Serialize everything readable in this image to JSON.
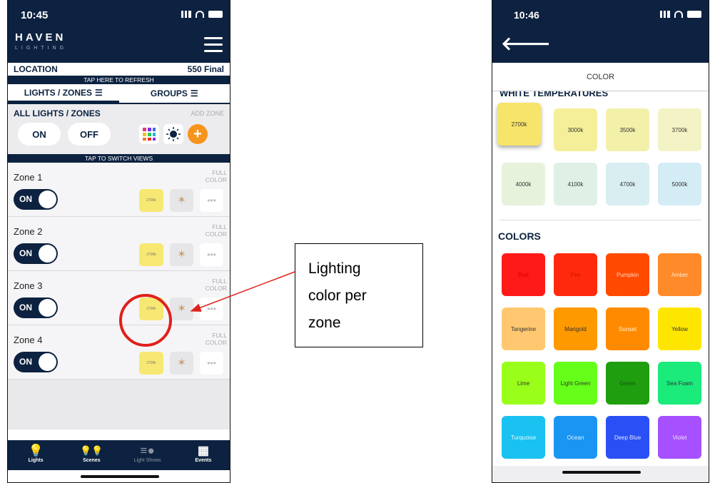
{
  "left": {
    "time": "10:45",
    "brand": "HAVEN",
    "brand_sub": "LIGHTING",
    "location_label": "LOCATION",
    "location_value": "550 Final",
    "refresh": "TAP HERE TO REFRESH",
    "tabs": [
      "LIGHTS / ZONES",
      "GROUPS"
    ],
    "all_title": "ALL LIGHTS / ZONES",
    "add_zone": "ADD ZONE",
    "on": "ON",
    "off": "OFF",
    "switch_views": "TAP TO SWITCH VIEWS",
    "zones": [
      {
        "name": "Zone 1",
        "full": "FULL",
        "color": "COLOR",
        "state": "ON",
        "swatch": "2700k"
      },
      {
        "name": "Zone 2",
        "full": "FULL",
        "color": "COLOR",
        "state": "ON",
        "swatch": "2700k"
      },
      {
        "name": "Zone 3",
        "full": "FULL",
        "color": "COLOR",
        "state": "ON",
        "swatch": "2700k"
      },
      {
        "name": "Zone 4",
        "full": "FULL",
        "color": "COLOR",
        "state": "ON",
        "swatch": "2700k"
      }
    ],
    "nav": [
      "Lights",
      "Scenes",
      "Light Shows",
      "Events"
    ]
  },
  "callout": {
    "line1": "Lighting",
    "line2": "color per",
    "line3": "zone"
  },
  "right": {
    "time": "10:46",
    "title": "COLOR",
    "white_header": "WHITE TEMPERATURES",
    "colors_header": "COLORS",
    "temps": [
      {
        "label": "2700k",
        "bg": "#f7e46a"
      },
      {
        "label": "3000k",
        "bg": "#f6ef9a"
      },
      {
        "label": "3500k",
        "bg": "#f3f0aa"
      },
      {
        "label": "3700k",
        "bg": "#f4f3c6"
      },
      {
        "label": "4000k",
        "bg": "#e7f2dc"
      },
      {
        "label": "4100k",
        "bg": "#dff0e6"
      },
      {
        "label": "4700k",
        "bg": "#d8eef0"
      },
      {
        "label": "5000k",
        "bg": "#d4ecf5"
      }
    ],
    "colors": [
      {
        "label": "Red",
        "bg": "#ff1a1a",
        "fg": "#d80000"
      },
      {
        "label": "Fire",
        "bg": "#ff2a0d",
        "fg": "#d01000"
      },
      {
        "label": "Pumpkin",
        "bg": "#ff4a00",
        "fg": "#ffd6c2"
      },
      {
        "label": "Amber",
        "bg": "#ff8a2a",
        "fg": "#ffe8cc"
      },
      {
        "label": "Tangerine",
        "bg": "#ffc870",
        "fg": "#333"
      },
      {
        "label": "Marigold",
        "bg": "#ff9900",
        "fg": "#333"
      },
      {
        "label": "Sunset",
        "bg": "#ff8a00",
        "fg": "#fff3e0"
      },
      {
        "label": "Yellow",
        "bg": "#ffe600",
        "fg": "#333"
      },
      {
        "label": "Lime",
        "bg": "#99ff1a",
        "fg": "#333"
      },
      {
        "label": "Light Green",
        "bg": "#66ff1a",
        "fg": "#333"
      },
      {
        "label": "Green",
        "bg": "#1f9e0f",
        "fg": "#0a5a05"
      },
      {
        "label": "Sea Foam",
        "bg": "#1aeb7a",
        "fg": "#333"
      },
      {
        "label": "Turquoise",
        "bg": "#19c2f0",
        "fg": "#e6f9ff"
      },
      {
        "label": "Ocean",
        "bg": "#1a96f2",
        "fg": "#dff0ff"
      },
      {
        "label": "Deep Blue",
        "bg": "#2a50f5",
        "fg": "#e0e6ff"
      },
      {
        "label": "Violet",
        "bg": "#a650ff",
        "fg": "#f0e2ff"
      }
    ]
  }
}
